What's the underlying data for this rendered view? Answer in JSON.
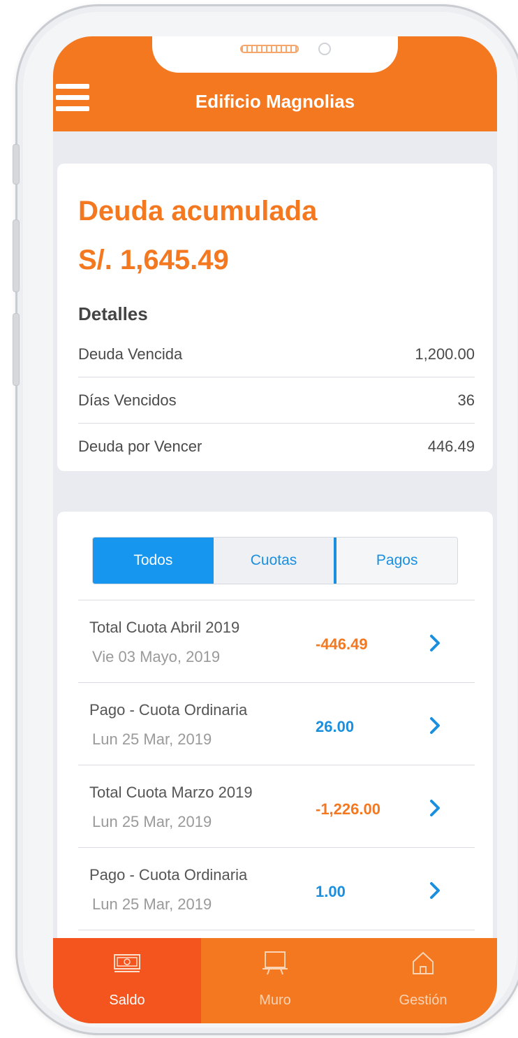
{
  "header": {
    "title": "Edificio Magnolias",
    "menu_icon": "hamburger-menu-icon",
    "color": "#f47820"
  },
  "summary": {
    "title": "Deuda acumulada",
    "amount": "S/. 1,645.49",
    "details_label": "Detalles",
    "rows": [
      {
        "label": "Deuda Vencida",
        "value": "1,200.00"
      },
      {
        "label": "Días Vencidos",
        "value": "36"
      },
      {
        "label": "Deuda por Vencer",
        "value": "446.49"
      }
    ]
  },
  "filter_tabs": [
    {
      "label": "Todos",
      "active": true
    },
    {
      "label": "Cuotas",
      "active": false
    },
    {
      "label": "Pagos",
      "active": false
    }
  ],
  "transactions": [
    {
      "title": "Total Cuota Abril 2019",
      "date": "Vie 03 Mayo, 2019",
      "amount": "-446.49",
      "kind": "debit"
    },
    {
      "title": "Pago - Cuota Ordinaria",
      "date": "Lun 25 Mar, 2019",
      "amount": "26.00",
      "kind": "credit"
    },
    {
      "title": "Total Cuota Marzo 2019",
      "date": "Lun 25 Mar, 2019",
      "amount": "-1,226.00",
      "kind": "debit"
    },
    {
      "title": "Pago - Cuota Ordinaria",
      "date": "Lun 25 Mar, 2019",
      "amount": "1.00",
      "kind": "credit"
    }
  ],
  "bottom_nav": [
    {
      "label": "Saldo",
      "icon": "money-bill-icon",
      "active": true
    },
    {
      "label": "Muro",
      "icon": "board-icon",
      "active": false
    },
    {
      "label": "Gestión",
      "icon": "home-icon",
      "active": false
    }
  ],
  "colors": {
    "primary_orange": "#f47820",
    "active_nav": "#f4551f",
    "accent_blue": "#1a8fe0"
  }
}
